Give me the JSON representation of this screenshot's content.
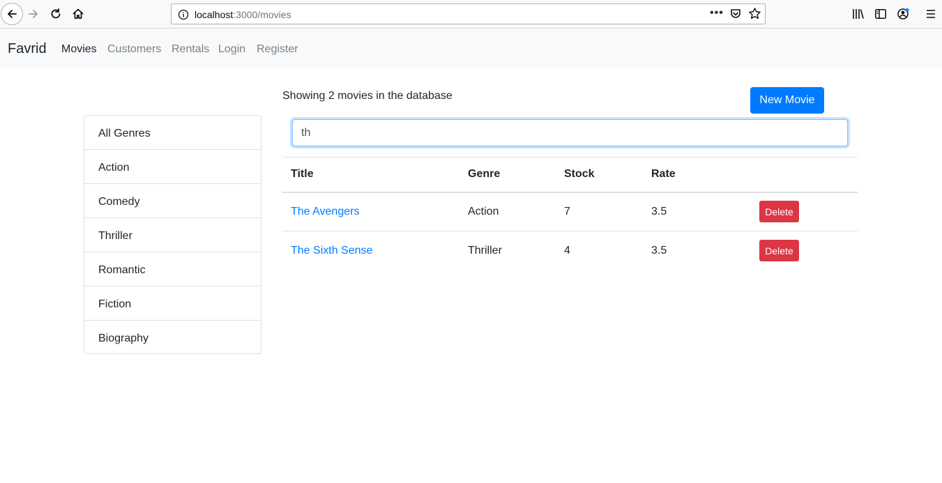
{
  "browser": {
    "url_host": "localhost",
    "url_path": ":3000/movies",
    "url_dots": "•••"
  },
  "navbar": {
    "brand": "Favrid",
    "links": [
      "Movies",
      "Customers",
      "Rentals",
      "Login",
      "Register"
    ],
    "active": "Movies"
  },
  "sidebar": {
    "genres": [
      "All Genres",
      "Action",
      "Comedy",
      "Thriller",
      "Romantic",
      "Fiction",
      "Biography"
    ]
  },
  "main": {
    "showing_text": "Showing 2 movies in the database",
    "new_movie_label": "New Movie",
    "search_value": "th",
    "table": {
      "headers": [
        "Title",
        "Genre",
        "Stock",
        "Rate"
      ],
      "rows": [
        {
          "title": "The Avengers",
          "genre": "Action",
          "stock": "7",
          "rate": "3.5",
          "action": "Delete"
        },
        {
          "title": "The Sixth Sense",
          "genre": "Thriller",
          "stock": "4",
          "rate": "3.5",
          "action": "Delete"
        }
      ]
    }
  },
  "colors": {
    "primary": "#007bff",
    "danger": "#dc3545",
    "navbar_bg": "#f8f9fa"
  },
  "icons": [
    "back-arrow-icon",
    "forward-arrow-icon",
    "reload-icon",
    "home-icon",
    "info-icon",
    "pocket-icon",
    "star-icon",
    "library-icon",
    "sidebar-icon",
    "account-icon",
    "menu-icon"
  ]
}
